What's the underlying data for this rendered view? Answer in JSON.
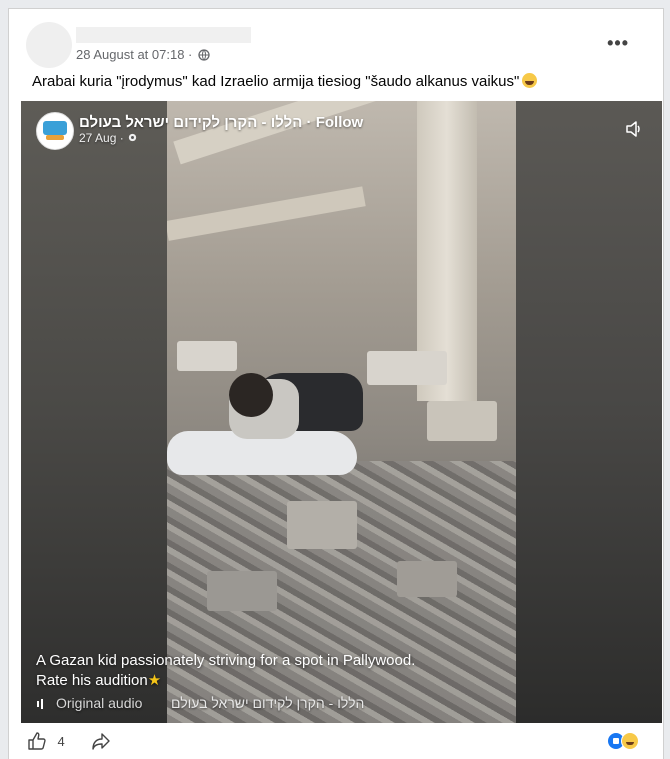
{
  "post": {
    "meta": "28 August at 07:18 ·",
    "more_icon": "more-options-icon",
    "text": "Arabai kuria \"įrodymus\" kad Izraelio armija tiesiog \"šaudo alkanus vaikus\"",
    "emoji": "grinning-squint-emoji"
  },
  "video": {
    "page_name": "הללו - הקרן לקידום ישראל בעולם · Follow",
    "date": "27 Aug ·",
    "caption_line1": "A Gazan kid passionately striving for a spot in Pallywood.",
    "caption_line2": "Rate his audition",
    "caption_emoji": "star-emoji",
    "audio_label": "Original audio",
    "audio_page": "הללו - הקרן לקידום ישראל בעולם"
  },
  "actions": {
    "like_count": "4",
    "reactions": [
      "like",
      "haha"
    ]
  },
  "colors": {
    "accent": "#1877f2",
    "meta_text": "#65676b"
  }
}
